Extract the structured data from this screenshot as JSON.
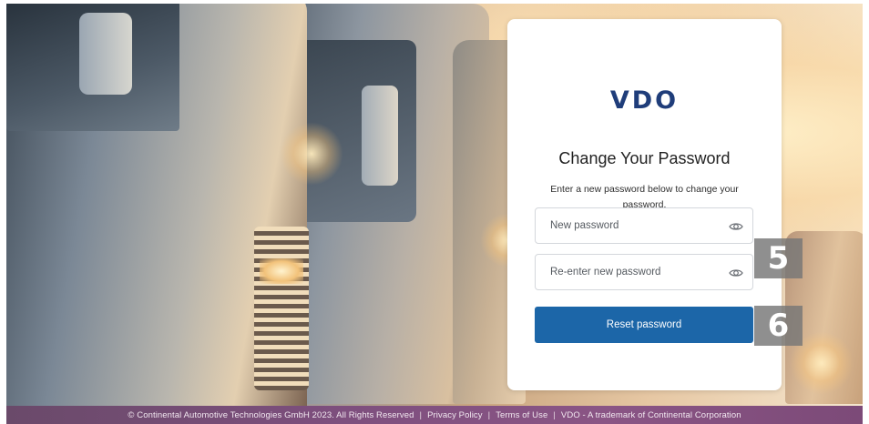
{
  "brand": {
    "logo_text": "VDO",
    "color": "#1f3d7a"
  },
  "form": {
    "title": "Change Your Password",
    "description": "Enter a new password below to change your password.",
    "new_password_placeholder": "New password",
    "reenter_password_placeholder": "Re-enter new password",
    "submit_label": "Reset password",
    "button_color": "#1c66a8"
  },
  "annotations": {
    "marker_5": "5",
    "marker_6": "6"
  },
  "footer": {
    "copyright": "© Continental Automotive Technologies GmbH 2023. All Rights Reserved",
    "privacy": "Privacy Policy",
    "terms": "Terms of Use",
    "trademark": "VDO - A trademark of Continental Corporation",
    "separator": "|"
  },
  "icons": {
    "password_toggle": "eye-icon"
  }
}
